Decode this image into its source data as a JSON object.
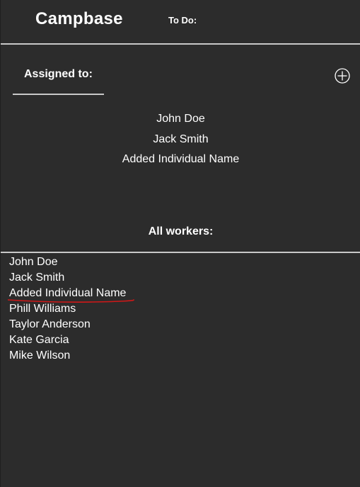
{
  "header": {
    "app_title": "Campbase",
    "todo_label": "To Do:"
  },
  "assigned": {
    "heading": "Assigned to:",
    "add_icon": "plus-circle-icon",
    "items": [
      {
        "name": "John Doe"
      },
      {
        "name": "Jack Smith"
      },
      {
        "name": "Added Individual Name"
      }
    ]
  },
  "workers": {
    "heading": "All workers:",
    "items": [
      {
        "name": "John Doe"
      },
      {
        "name": "Jack Smith"
      },
      {
        "name": "Added Individual Name"
      },
      {
        "name": "Phill Williams"
      },
      {
        "name": "Taylor Anderson"
      },
      {
        "name": "Kate Garcia"
      },
      {
        "name": "Mike Wilson"
      }
    ]
  },
  "colors": {
    "background": "#2c2c2c",
    "text": "#ffffff",
    "divider": "#c8c8c8",
    "spellcheck_underline": "#d01818"
  }
}
